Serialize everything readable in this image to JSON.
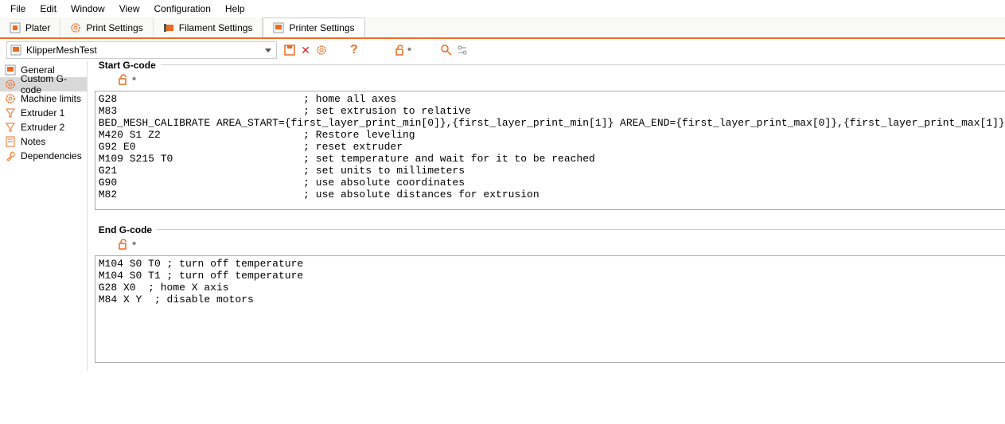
{
  "menu": {
    "file": "File",
    "edit": "Edit",
    "window": "Window",
    "view": "View",
    "config": "Configuration",
    "help": "Help"
  },
  "tabs": {
    "plater": "Plater",
    "print": "Print Settings",
    "filament": "Filament Settings",
    "printer": "Printer Settings"
  },
  "preset": {
    "name": "KlipperMeshTest"
  },
  "sidebar": {
    "general": "General",
    "custom": "Custom G-code",
    "machine": "Machine limits",
    "ex1": "Extruder 1",
    "ex2": "Extruder 2",
    "notes": "Notes",
    "deps": "Dependencies"
  },
  "sections": {
    "start_title": "Start G-code",
    "end_title": "End G-code",
    "start_code": "G28                              ; home all axes\nM83                              ; set extrusion to relative\nBED_MESH_CALIBRATE AREA_START={first_layer_print_min[0]},{first_layer_print_min[1]} AREA_END={first_layer_print_max[0]},{first_layer_print_max[1]}\nM420 S1 Z2                       ; Restore leveling\nG92 E0                           ; reset extruder\nM109 S215 T0                     ; set temperature and wait for it to be reached\nG21                              ; set units to millimeters\nG90                              ; use absolute coordinates\nM82                              ; use absolute distances for extrusion",
    "end_code": "M104 S0 T0 ; turn off temperature\nM104 S0 T1 ; turn off temperature\nG28 X0  ; home X axis\nM84 X Y  ; disable motors"
  }
}
